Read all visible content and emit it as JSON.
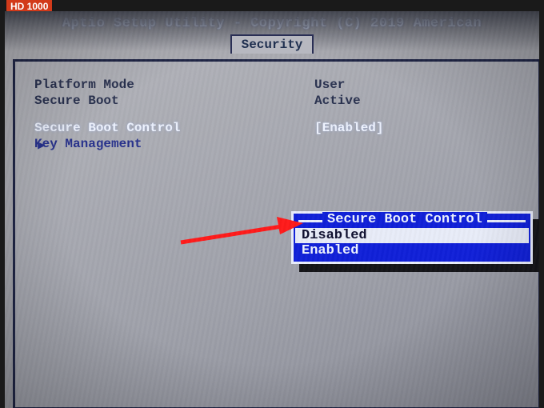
{
  "corner_label": "HD 1000",
  "header": {
    "title": "Aptio Setup Utility - Copyright (C) 2019 American"
  },
  "tab": {
    "label": "Security"
  },
  "rows": {
    "platform_mode": {
      "label": "Platform Mode",
      "value": "User"
    },
    "secure_boot": {
      "label": "Secure Boot",
      "value": "Active"
    },
    "secure_boot_control": {
      "label": "Secure Boot Control",
      "value": "[Enabled]"
    },
    "key_management": {
      "label": "Key Management"
    }
  },
  "popup": {
    "title": "Secure Boot Control",
    "options": {
      "disabled": "Disabled",
      "enabled": "Enabled"
    }
  }
}
